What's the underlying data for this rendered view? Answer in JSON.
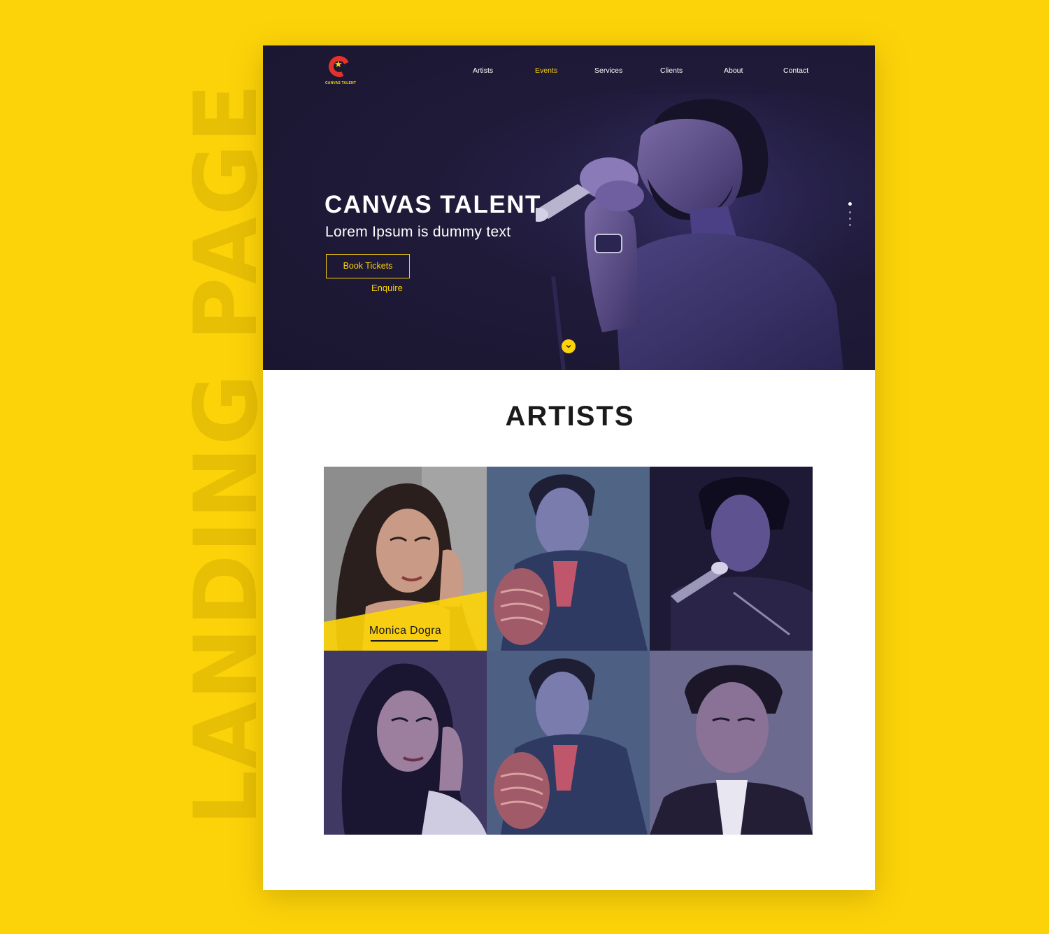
{
  "side_title": "LANDING PAGE",
  "logo": {
    "text": "CANVAS TALENT"
  },
  "nav": {
    "items": [
      {
        "label": "Artists",
        "active": false
      },
      {
        "label": "Events",
        "active": true
      },
      {
        "label": "Services",
        "active": false
      },
      {
        "label": "Clients",
        "active": false
      },
      {
        "label": "About",
        "active": false
      },
      {
        "label": "Contact",
        "active": false
      }
    ]
  },
  "hero": {
    "title": "CANVAS TALENT",
    "subtitle": "Lorem Ipsum is dummy text",
    "primary_button": "Book Tickets",
    "secondary_link": "Enquire",
    "slider": {
      "total": 4,
      "active_index": 0
    },
    "scroll_icon": "chevron-down-icon"
  },
  "artists_section": {
    "title": "ARTISTS",
    "featured_caption": "Monica Dogra",
    "tiles": [
      {
        "photo": "woman-portrait",
        "highlighted": true
      },
      {
        "photo": "man-with-hat"
      },
      {
        "photo": "man-singing-mic"
      },
      {
        "photo": "woman-portrait"
      },
      {
        "photo": "man-with-hat"
      },
      {
        "photo": "man-portrait"
      }
    ]
  },
  "colors": {
    "background": "#FCD309",
    "side_title": "#E7BF05",
    "hero_bg": "#1F1A38",
    "accent": "#FCD309",
    "logo_red": "#E2322A",
    "text_dark": "#1A1A1A"
  }
}
